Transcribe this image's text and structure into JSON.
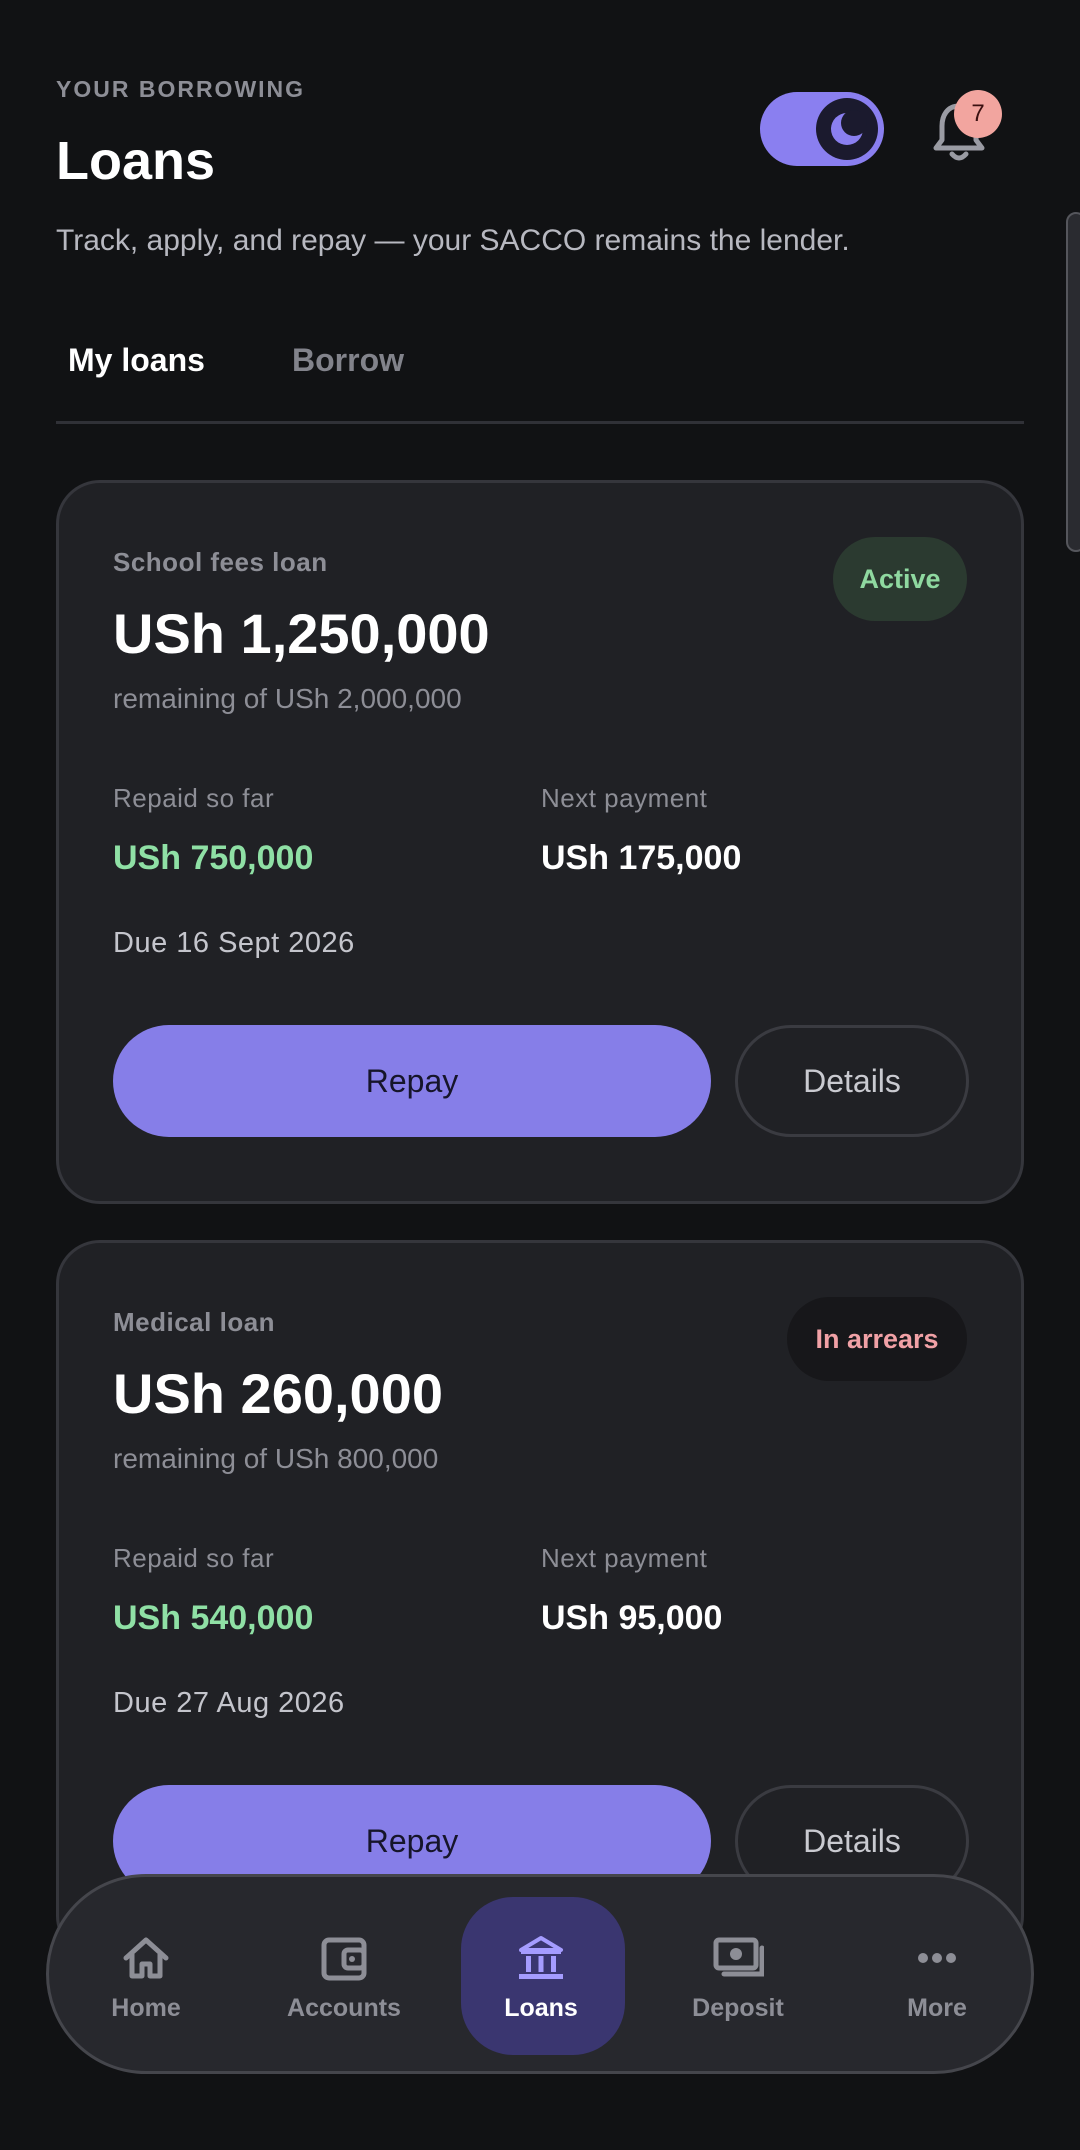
{
  "header": {
    "eyebrow": "YOUR BORROWING",
    "title": "Loans",
    "subtitle": "Track, apply, and repay — your SACCO remains the lender.",
    "notification_count": "7"
  },
  "tabs": [
    {
      "label": "My loans",
      "active": true
    },
    {
      "label": "Borrow",
      "active": false
    }
  ],
  "loans": [
    {
      "name": "School fees loan",
      "amount": "USh 1,250,000",
      "remaining": "remaining of USh 2,000,000",
      "status": "Active",
      "repaid_label": "Repaid so far",
      "repaid_value": "USh 750,000",
      "next_label": "Next payment",
      "next_value": "USh 175,000",
      "due": "Due 16 Sept 2026",
      "repay_label": "Repay",
      "details_label": "Details"
    },
    {
      "name": "Medical loan",
      "amount": "USh 260,000",
      "remaining": "remaining of USh 800,000",
      "status": "In arrears",
      "repaid_label": "Repaid so far",
      "repaid_value": "USh 540,000",
      "next_label": "Next payment",
      "next_value": "USh 95,000",
      "due": "Due 27 Aug 2026",
      "repay_label": "Repay",
      "details_label": "Details"
    }
  ],
  "nav": [
    {
      "label": "Home",
      "icon": "home-icon"
    },
    {
      "label": "Accounts",
      "icon": "wallet-icon"
    },
    {
      "label": "Loans",
      "icon": "bank-icon",
      "active": true
    },
    {
      "label": "Deposit",
      "icon": "cash-icon"
    },
    {
      "label": "More",
      "icon": "more-icon"
    }
  ],
  "colors": {
    "accent": "#867ee8",
    "background": "#111214",
    "card": "#202125",
    "success": "#8fe0a5",
    "danger": "#f1a1a6"
  }
}
